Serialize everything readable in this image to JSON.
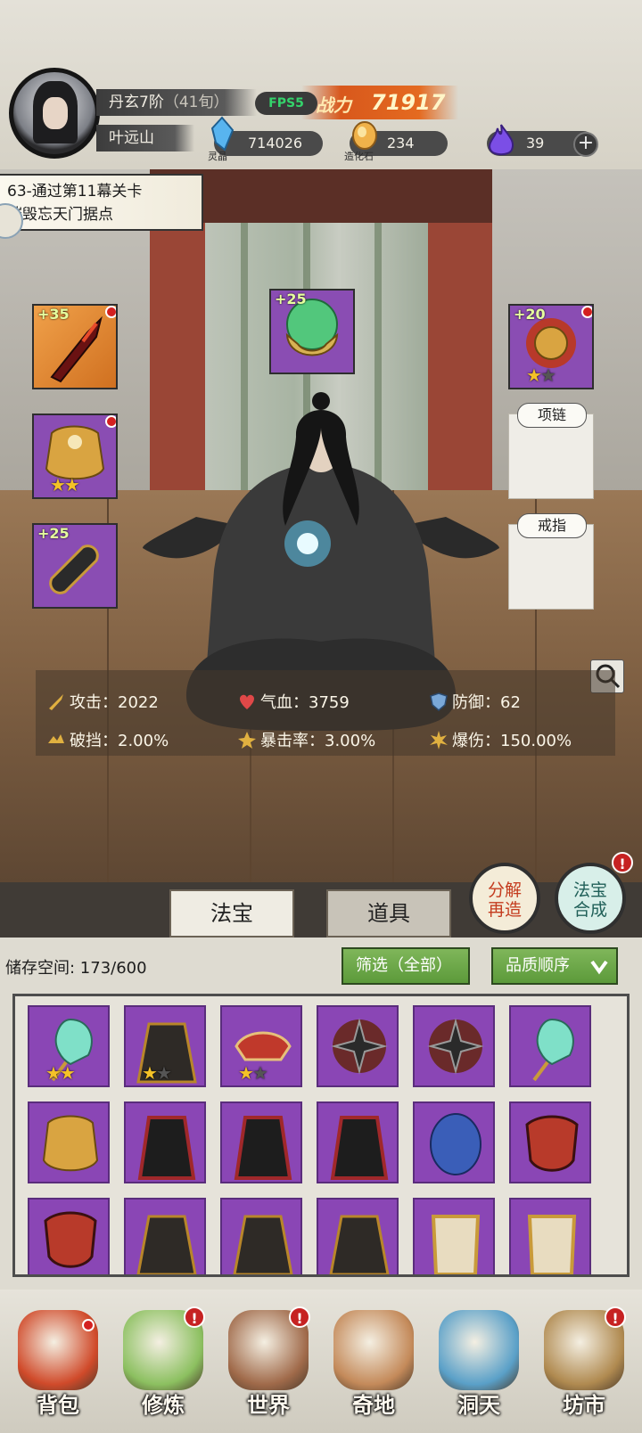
{
  "player": {
    "rank": "丹玄7阶",
    "age": "（41旬）",
    "name": "叶远山",
    "fps": "FPS5",
    "power_label": "战力",
    "power_value": "71917"
  },
  "resources": [
    {
      "label": "灵晶",
      "value": "714026",
      "icon": "crystal-icon",
      "color": "#4aa3e0"
    },
    {
      "label": "造化石",
      "value": "234",
      "icon": "stone-icon",
      "color": "#e8a23a"
    },
    {
      "label": "",
      "value": "39",
      "icon": "purple-flame-icon",
      "color": "#7a4de8"
    }
  ],
  "quest": {
    "line1": "63-通过第11幕关卡",
    "line2": "摧毁忘天门据点"
  },
  "equipment": {
    "left": [
      {
        "plus": "+35",
        "icon": "crimson-blade-icon",
        "stars": 0,
        "alert": true
      },
      {
        "plus": "",
        "icon": "golden-armor-icon",
        "stars": 2,
        "alert": true
      },
      {
        "plus": "+25",
        "icon": "bracer-icon",
        "stars": 0,
        "alert": false
      }
    ],
    "center": {
      "plus": "+25",
      "icon": "jade-talisman-icon"
    },
    "right_top": {
      "plus": "+20",
      "icon": "golden-lion-icon",
      "stars": 1,
      "alert": true
    },
    "necklace_label": "项链",
    "ring_label": "戒指"
  },
  "stats": [
    {
      "label": "攻击：2022",
      "icon": "sword-icon",
      "color": "#e0b040"
    },
    {
      "label": "气血：3759",
      "icon": "heart-icon",
      "color": "#e04848"
    },
    {
      "label": "防御：62",
      "icon": "shield-icon",
      "color": "#7aa8d8"
    },
    {
      "label": "破挡：2.00%",
      "icon": "break-icon",
      "color": "#e0b040"
    },
    {
      "label": "暴击率：3.00%",
      "icon": "crit-icon",
      "color": "#e0b040"
    },
    {
      "label": "爆伤：150.00%",
      "icon": "burst-icon",
      "color": "#e0b040"
    }
  ],
  "tabs": [
    "法宝",
    "道具"
  ],
  "actions": {
    "decompose": [
      "分解",
      "再造"
    ],
    "synthesize": [
      "法宝",
      "合成"
    ]
  },
  "storage": {
    "label": "储存空间: 173/600",
    "filter": "筛选（全部）",
    "sort": "品质顺序"
  },
  "inventory": [
    {
      "icon": "jade-fan-icon",
      "stars": 2
    },
    {
      "icon": "dark-robe-icon",
      "stars": 1
    },
    {
      "icon": "red-crown-icon",
      "stars": 1
    },
    {
      "icon": "shuriken-icon",
      "stars": 0
    },
    {
      "icon": "shuriken-icon",
      "stars": 0
    },
    {
      "icon": "jade-fan-icon",
      "stars": 0
    },
    {
      "icon": "golden-armor-icon",
      "stars": 0
    },
    {
      "icon": "shadow-robe-icon",
      "stars": 0
    },
    {
      "icon": "shadow-robe-icon",
      "stars": 0
    },
    {
      "icon": "shadow-robe-icon",
      "stars": 0
    },
    {
      "icon": "blue-robe-icon",
      "stars": 0
    },
    {
      "icon": "demon-armor-icon",
      "stars": 0
    },
    {
      "icon": "demon-armor-icon",
      "stars": 0
    },
    {
      "icon": "dark-robe-icon",
      "stars": 0
    },
    {
      "icon": "dark-robe-icon",
      "stars": 0
    },
    {
      "icon": "dark-robe-icon",
      "stars": 0
    },
    {
      "icon": "gold-plate-icon",
      "stars": 0
    },
    {
      "icon": "gold-plate-icon",
      "stars": 0
    }
  ],
  "nav": [
    {
      "label": "背包",
      "icon": "bag-icon",
      "alert": false,
      "dot": true,
      "color": "#d04a2a"
    },
    {
      "label": "修炼",
      "icon": "lotus-icon",
      "alert": true,
      "color": "#8cc060"
    },
    {
      "label": "世界",
      "icon": "scroll-icon",
      "alert": true,
      "color": "#a06a4a"
    },
    {
      "label": "奇地",
      "icon": "palace-icon",
      "alert": false,
      "color": "#c48a5a"
    },
    {
      "label": "洞天",
      "icon": "portal-icon",
      "alert": false,
      "color": "#5aa0c8"
    },
    {
      "label": "坊市",
      "icon": "market-icon",
      "alert": true,
      "color": "#b08a50"
    }
  ],
  "alert_mark": "!"
}
